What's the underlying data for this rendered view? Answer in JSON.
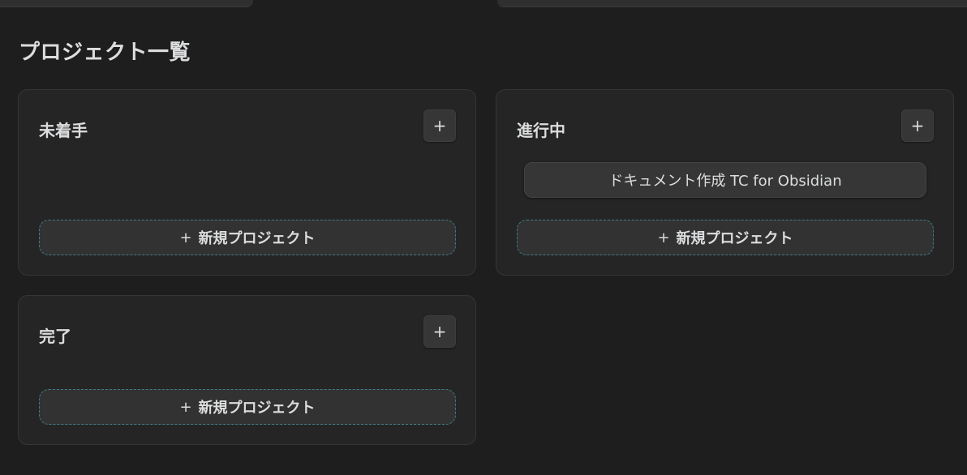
{
  "page": {
    "title": "プロジェクト一覧"
  },
  "columns": [
    {
      "title": "未着手",
      "add_label": "+",
      "cards": [],
      "new_project_label": "新規プロジェクト"
    },
    {
      "title": "進行中",
      "add_label": "+",
      "cards": [
        "ドキュメント作成 TC for Obsidian"
      ],
      "new_project_label": "新規プロジェクト"
    },
    {
      "title": "完了",
      "add_label": "+",
      "cards": [],
      "new_project_label": "新規プロジェクト"
    }
  ],
  "new_project_prefix": "+",
  "colors": {
    "background": "#1e1e1e",
    "column_bg": "#252525",
    "card_bg": "#363636",
    "dashed_accent": "#3f7b86",
    "text": "#dcddde"
  }
}
